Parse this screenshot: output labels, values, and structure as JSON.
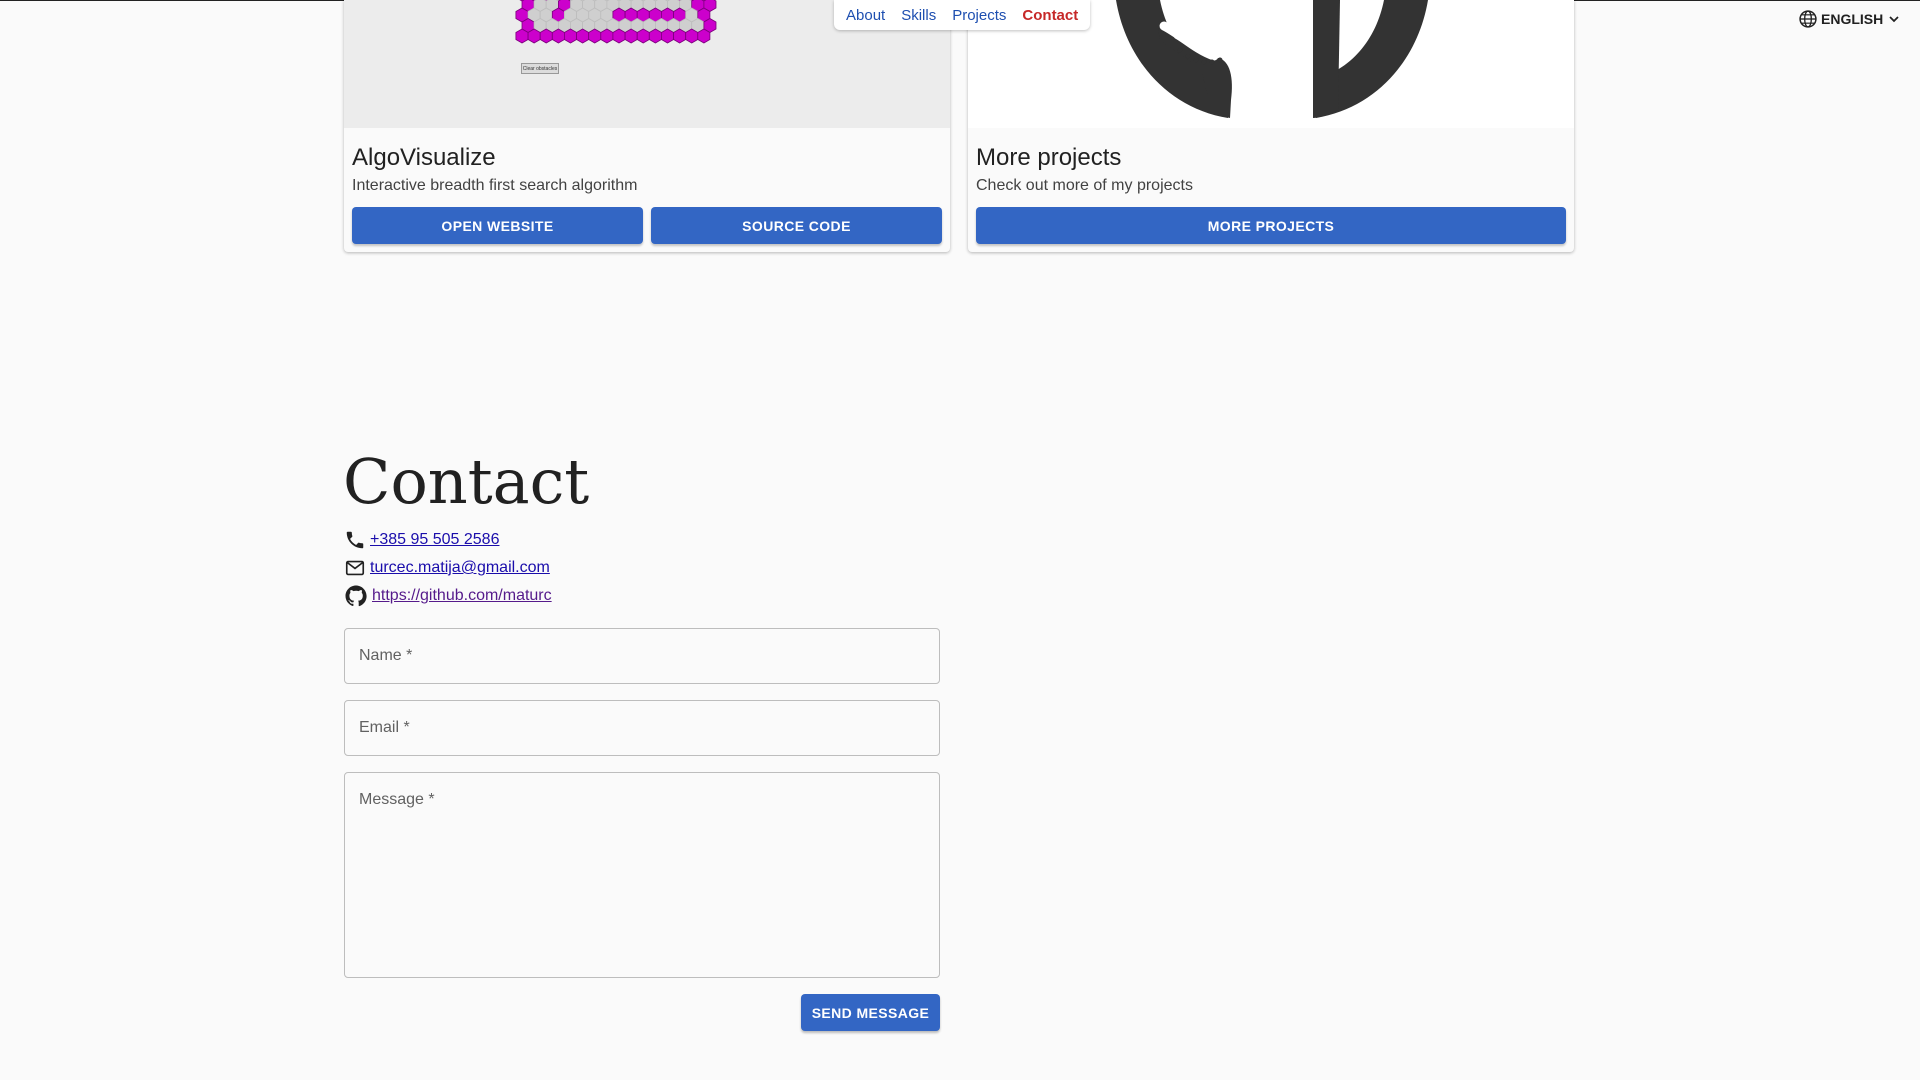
{
  "nav": {
    "items": [
      {
        "label": "About"
      },
      {
        "label": "Skills"
      },
      {
        "label": "Projects"
      },
      {
        "label": "Contact"
      }
    ],
    "active": "Contact"
  },
  "language": {
    "label": "ENGLISH",
    "icon": "globe-icon"
  },
  "projects": [
    {
      "title": "AlgoVisualize",
      "description": "Interactive breadth first search algorithm",
      "buttons": [
        "OPEN WEBSITE",
        "SOURCE CODE"
      ],
      "preview_button": "Clear obstacles"
    },
    {
      "title": "More projects",
      "description": "Check out more of my projects",
      "buttons": [
        "MORE PROJECTS"
      ],
      "image_icon": "github-octocat-icon"
    }
  ],
  "contact": {
    "title": "Contact",
    "phone": "+385 95 505 2586",
    "email": "turcec.matija@gmail.com",
    "github": "https://github.com/maturc",
    "form": {
      "name_label": "Name *",
      "email_label": "Email *",
      "message_label": "Message *",
      "submit_label": "SEND MESSAGE"
    }
  },
  "colors": {
    "primary": "#3366c4",
    "nav_link": "#1e4fb0",
    "nav_active": "#c62828",
    "hex_fill": "#cc00cc",
    "background": "#fafafa"
  }
}
